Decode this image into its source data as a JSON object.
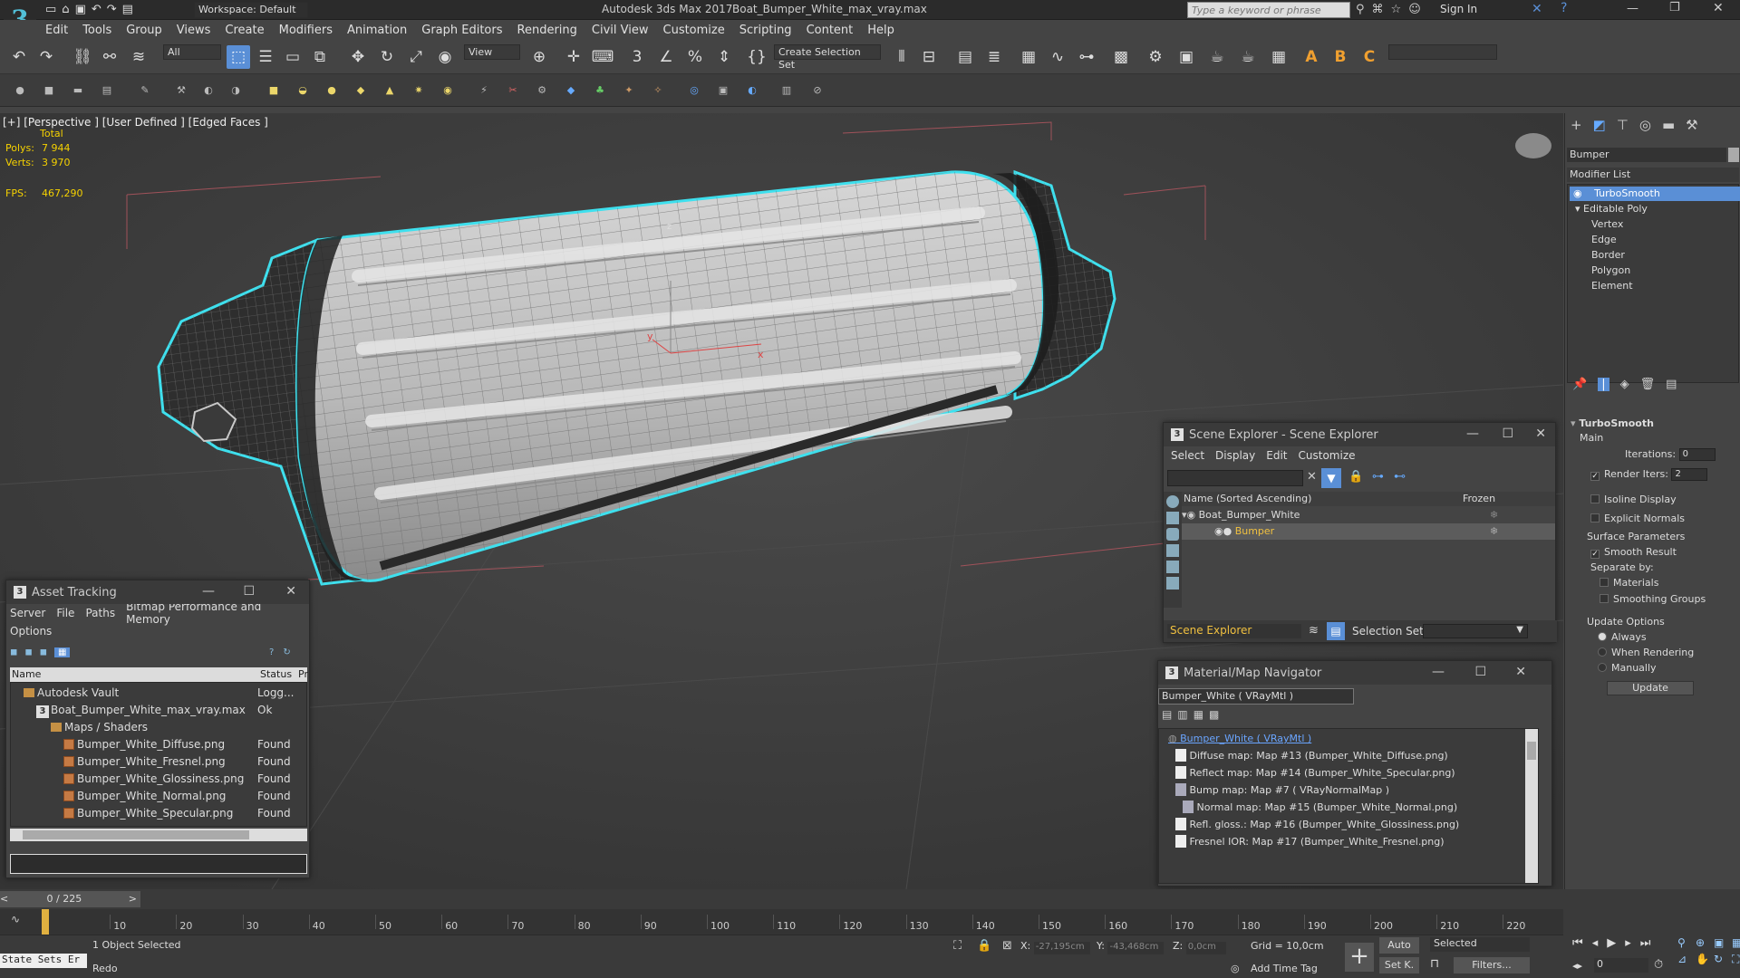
{
  "title_bar": {
    "app_title": "Autodesk 3ds Max 2017",
    "file_title": "Boat_Bumper_White_max_vray.max",
    "workspace": "Workspace: Default",
    "search_placeholder": "Type a keyword or phrase",
    "sign_in": "Sign In"
  },
  "menu": [
    "Edit",
    "Tools",
    "Group",
    "Views",
    "Create",
    "Modifiers",
    "Animation",
    "Graph Editors",
    "Rendering",
    "Civil View",
    "Customize",
    "Scripting",
    "Content",
    "Help"
  ],
  "toolbar": {
    "selection_filter": "All",
    "ref_coord": "View",
    "named_selection": "Create Selection Set"
  },
  "viewport": {
    "label": "[+] [Perspective ] [User Defined ] [Edged Faces ]",
    "stats_total": "Total",
    "polys_label": "Polys:",
    "polys_value": "7 944",
    "verts_label": "Verts:",
    "verts_value": "3 970",
    "fps_label": "FPS:",
    "fps_value": "467,290",
    "axis_x": "x",
    "axis_y": "y",
    "axis_z": "z"
  },
  "scene_explorer": {
    "title": "Scene Explorer - Scene Explorer",
    "menu": [
      "Select",
      "Display",
      "Edit",
      "Customize"
    ],
    "col_name": "Name (Sorted Ascending)",
    "col_frozen": "Frozen",
    "items": [
      {
        "label": "Boat_Bumper_White"
      },
      {
        "label": "Bumper"
      }
    ],
    "footer_name": "Scene Explorer",
    "selection_set_label": "Selection Set:"
  },
  "asset_tracking": {
    "title": "Asset Tracking",
    "menu": [
      "Server",
      "File",
      "Paths",
      "Bitmap Performance and Memory"
    ],
    "menu2": "Options",
    "col_name": "Name",
    "col_status": "Status",
    "col_pr": "Pr",
    "rows": [
      {
        "name": "Autodesk Vault",
        "status": "Logg..."
      },
      {
        "name": "Boat_Bumper_White_max_vray.max",
        "status": "Ok"
      },
      {
        "name": "Maps / Shaders",
        "status": ""
      },
      {
        "name": "Bumper_White_Diffuse.png",
        "status": "Found"
      },
      {
        "name": "Bumper_White_Fresnel.png",
        "status": "Found"
      },
      {
        "name": "Bumper_White_Glossiness.png",
        "status": "Found"
      },
      {
        "name": "Bumper_White_Normal.png",
        "status": "Found"
      },
      {
        "name": "Bumper_White_Specular.png",
        "status": "Found"
      }
    ]
  },
  "material_navigator": {
    "title": "Material/Map Navigator",
    "field": "Bumper_White  ( VRayMtl )",
    "items": [
      "Bumper_White  ( VRayMtl )",
      "Diffuse map: Map #13 (Bumper_White_Diffuse.png)",
      "Reflect map: Map #14 (Bumper_White_Specular.png)",
      "Bump map: Map #7  ( VRayNormalMap )",
      "Normal map: Map #15 (Bumper_White_Normal.png)",
      "Refl. gloss.: Map #16 (Bumper_White_Glossiness.png)",
      "Fresnel IOR: Map #17 (Bumper_White_Fresnel.png)"
    ]
  },
  "command_panel": {
    "object_name": "Bumper",
    "modifier_list": "Modifier List",
    "stack": [
      "TurboSmooth",
      "Editable Poly",
      "Vertex",
      "Edge",
      "Border",
      "Polygon",
      "Element"
    ],
    "rollout_title": "TurboSmooth",
    "main": "Main",
    "iterations_label": "Iterations:",
    "iterations_value": "0",
    "render_iters_label": "Render Iters:",
    "render_iters_value": "2",
    "isoline": "Isoline Display",
    "explicit_normals": "Explicit Normals",
    "surface_params": "Surface Parameters",
    "smooth_result": "Smooth Result",
    "separate_by": "Separate by:",
    "materials": "Materials",
    "smoothing_groups": "Smoothing Groups",
    "update_options": "Update Options",
    "always": "Always",
    "when_rendering": "When Rendering",
    "manually": "Manually",
    "update_button": "Update"
  },
  "timeline": {
    "frame": "0 / 225",
    "ticks": [
      "10",
      "20",
      "30",
      "40",
      "50",
      "60",
      "70",
      "80",
      "90",
      "100",
      "110",
      "120",
      "130",
      "140",
      "150",
      "160",
      "170",
      "180",
      "190",
      "200",
      "210",
      "220"
    ]
  },
  "status": {
    "maxscript": "State Sets Er",
    "selected": "1 Object Selected",
    "prompt": "Redo",
    "x_label": "X:",
    "x_value": "-27,195cm",
    "y_label": "Y:",
    "y_value": "-43,468cm",
    "z_label": "Z:",
    "z_value": "0,0cm",
    "grid": "Grid = 10,0cm",
    "add_time_tag": "Add Time Tag",
    "auto": "Auto",
    "set_k": "Set K.",
    "selected_dd": "Selected",
    "filters": "Filters...",
    "frame_field": "0"
  }
}
